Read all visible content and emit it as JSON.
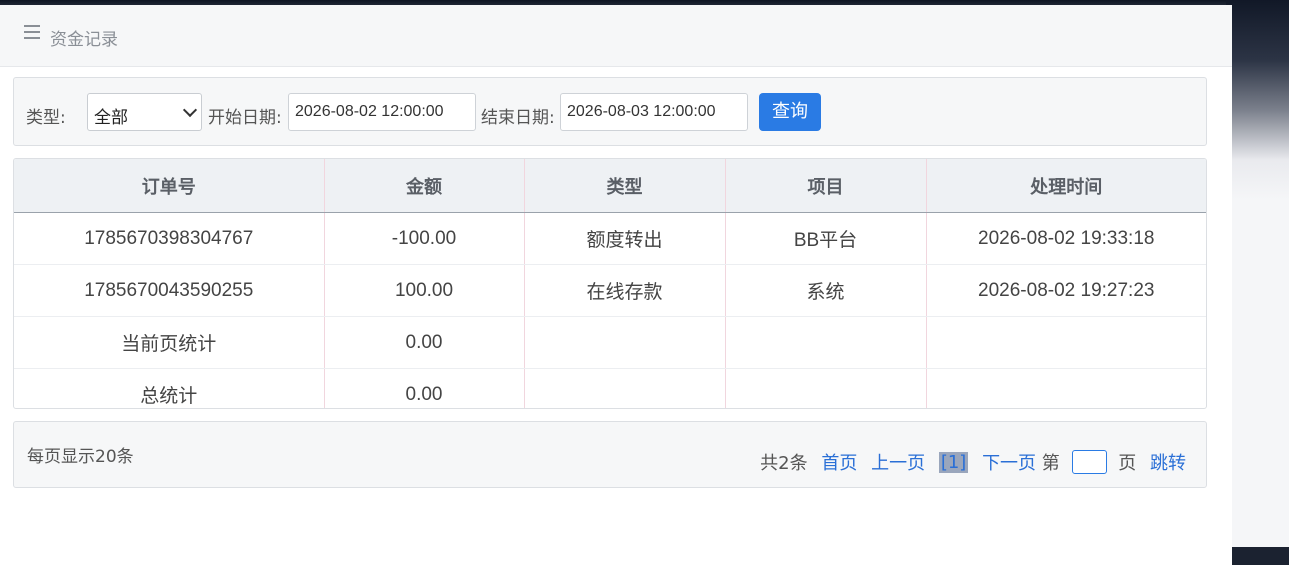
{
  "header": {
    "title": "资金记录",
    "icon": "menu-icon"
  },
  "filters": {
    "type_label": "类型:",
    "type_value": "全部",
    "start_label": "开始日期:",
    "start_value": "2026-08-02 12:00:00",
    "end_label": "结束日期:",
    "end_value": "2026-08-03 12:00:00",
    "query_button": "查询"
  },
  "table": {
    "columns": [
      "订单号",
      "金额",
      "类型",
      "项目",
      "处理时间"
    ],
    "rows": [
      [
        "1785670398304767",
        "-100.00",
        "额度转出",
        "BB平台",
        "2026-08-02 19:33:18"
      ],
      [
        "1785670043590255",
        "100.00",
        "在线存款",
        "系统",
        "2026-08-02 19:27:23"
      ],
      [
        "当前页统计",
        "0.00",
        "",
        "",
        ""
      ],
      [
        "总统计",
        "0.00",
        "",
        "",
        ""
      ]
    ]
  },
  "footer": {
    "per_page": "每页显示20条",
    "total": "共2条",
    "first": "首页",
    "prev": "上一页",
    "current": "[1]",
    "next": "下一页",
    "goto_prefix": "第",
    "goto_suffix": "页",
    "jump": "跳转"
  },
  "colors": {
    "accent": "#2a7be4",
    "link": "#2a6fd6"
  }
}
